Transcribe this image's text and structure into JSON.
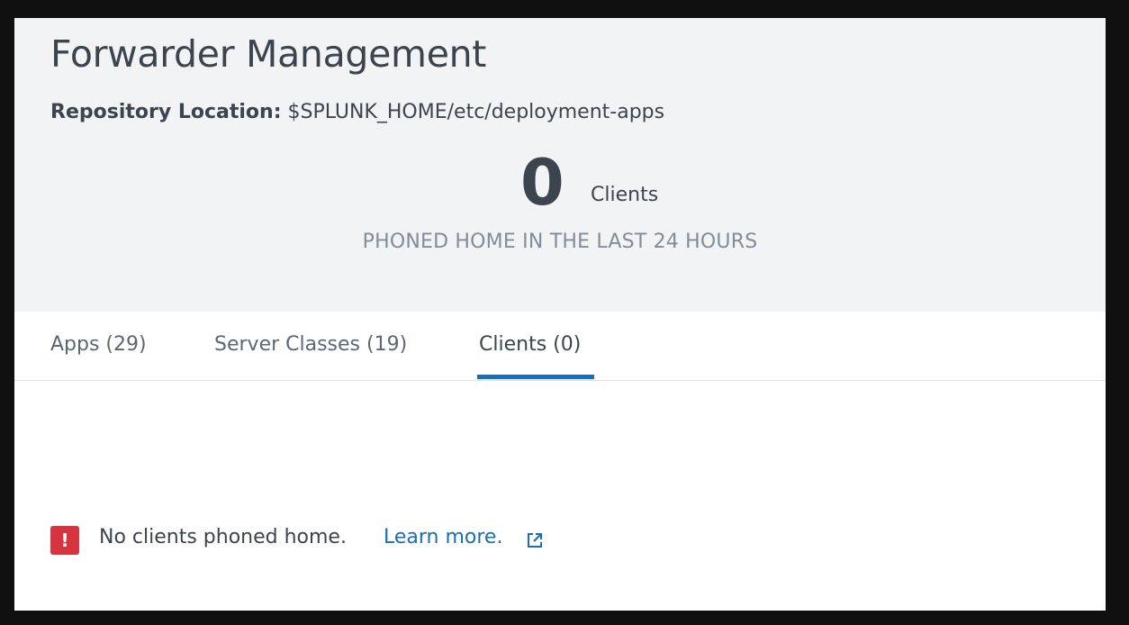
{
  "header": {
    "title": "Forwarder Management",
    "repository_label": "Repository Location:",
    "repository_path": "$SPLUNK_HOME/etc/deployment-apps",
    "client_count": "0",
    "client_unit": "Clients",
    "client_caption": "PHONED HOME IN THE LAST 24 HOURS"
  },
  "tabs": [
    {
      "label": "Apps (29)",
      "active": false
    },
    {
      "label": "Server Classes (19)",
      "active": false
    },
    {
      "label": "Clients (0)",
      "active": true
    }
  ],
  "message": {
    "icon": "error-icon",
    "icon_glyph": "!",
    "text": "No clients phoned home.",
    "link_label": "Learn more.",
    "link_icon": "external-link-icon"
  },
  "colors": {
    "header_bg": "#f2f3f5",
    "text": "#3c444d",
    "muted": "#818d99",
    "accent": "#1a6fb4",
    "error": "#d6343f"
  }
}
